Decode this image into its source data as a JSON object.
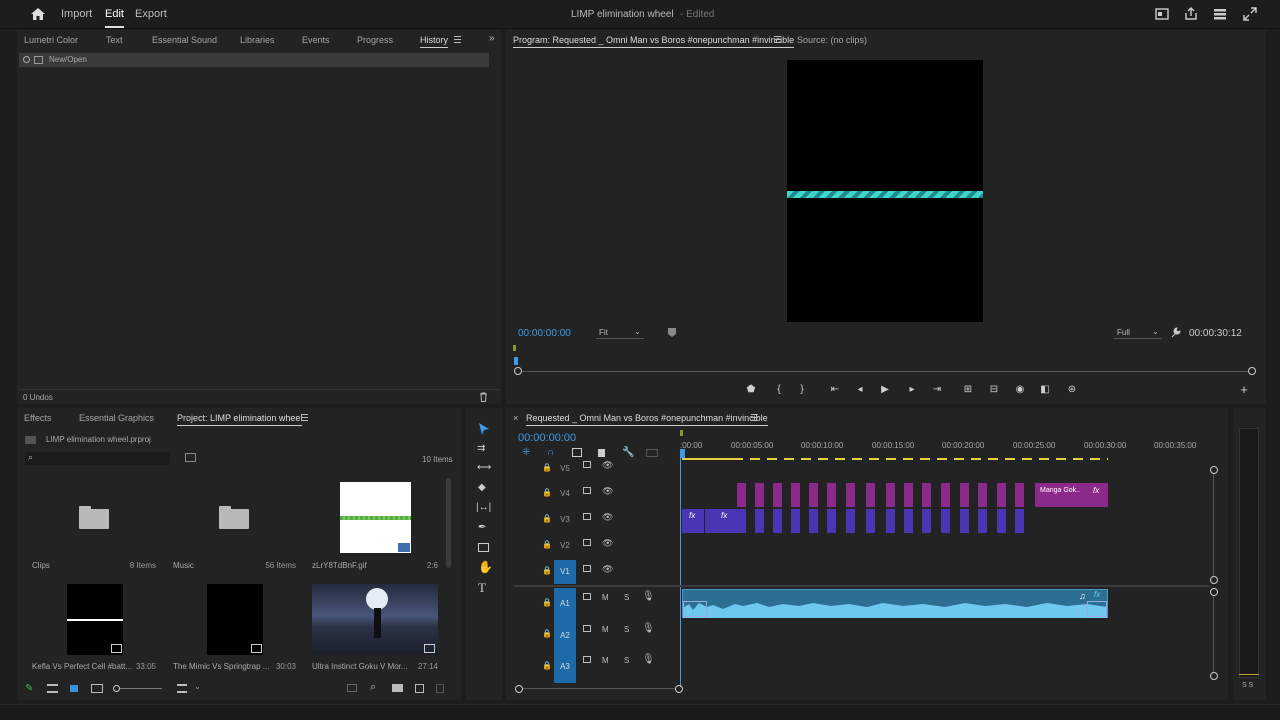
{
  "topbar": {
    "nav": [
      "Import",
      "Edit",
      "Export"
    ],
    "active_nav": "Edit",
    "title": "LIMP elimination wheel",
    "status": "- Edited"
  },
  "upper_left": {
    "tabs": [
      "Lumetri Color",
      "Text",
      "Essential Sound",
      "Libraries",
      "Events",
      "Progress",
      "History"
    ],
    "active_tab": "History",
    "history_item": "New/Open",
    "footer": "0 Undos"
  },
  "monitor": {
    "program_tab": "Program: Requested _ Omni Man vs Boros #onepunchman #invincible",
    "source_tab": "Source: (no clips)",
    "timecode": "00:00:00:00",
    "zoom": "Fit",
    "resolution": "Full",
    "duration": "00:00:30:12"
  },
  "project": {
    "tabs": [
      "Effects",
      "Essential Graphics",
      "Project: LIMP elimination wheel"
    ],
    "active_tab": "Project: LIMP elimination wheel",
    "filename": "LIMP elimination wheel.prproj",
    "item_count": "10 Items",
    "bins": [
      {
        "name": "Clips",
        "count": "8 Items"
      },
      {
        "name": "Music",
        "count": "56 Items"
      },
      {
        "name": "zLrY8TdBnF.gif",
        "count": "2:6"
      },
      {
        "name": "Kefla Vs Perfect Cell #batt...",
        "count": "33:05"
      },
      {
        "name": "The Mimic Vs Springtrap ...",
        "count": "30:03"
      },
      {
        "name": "Ultra Instinct Goku V Mor...",
        "count": "27:14"
      }
    ]
  },
  "timeline": {
    "sequence_tab": "Requested _ Omni Man vs Boros #onepunchman #invincible",
    "timecode": "00:00:00:00",
    "ruler": [
      ":00:00",
      "00:00:05:00",
      "00:00:10:00",
      "00:00:15:00",
      "00:00:20:00",
      "00:00:25:00",
      "00:00:30:00",
      "00:00:35:00"
    ],
    "video_tracks": [
      "V5",
      "V4",
      "V3",
      "V2",
      "V1"
    ],
    "audio_tracks": [
      "A1",
      "A2",
      "A3"
    ],
    "clip_label": "Manga Gok..",
    "fx": "fx",
    "mute": "M",
    "solo": "S",
    "meter_label": "S S"
  },
  "colors": {
    "accent": "#3d9ae6",
    "clip_purple": "#8b2a8a",
    "clip_blue": "#4a35b4",
    "audio": "#6ec8ef",
    "track_selected": "#1e6aa7"
  }
}
